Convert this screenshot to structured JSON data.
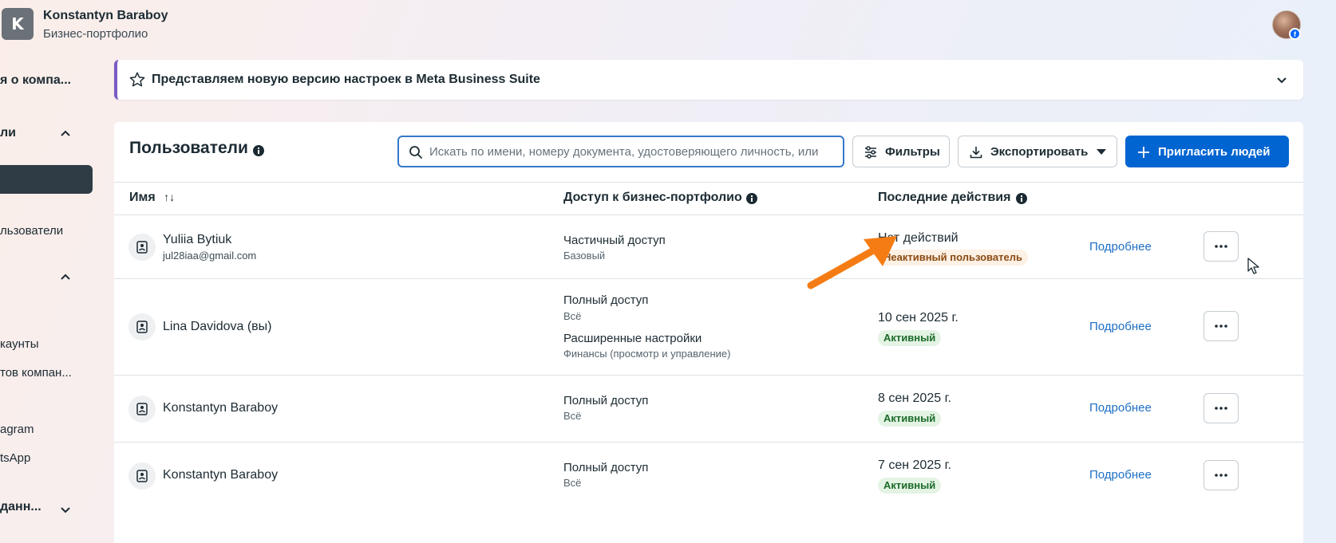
{
  "header": {
    "logo_letter": "K",
    "account_name": "Konstantyn Baraboy",
    "account_subtitle": "Бизнес-портфолио"
  },
  "sidebar": {
    "items": [
      {
        "label": "я о компа..."
      },
      {
        "label": "ли"
      },
      {
        "label": "льзователи"
      },
      {
        "label": "каунты"
      },
      {
        "label": "тов компан..."
      },
      {
        "label": "agram"
      },
      {
        "label": "tsApp"
      },
      {
        "label": "данн..."
      }
    ]
  },
  "banner": {
    "text": "Представляем новую версию настроек в Meta Business Suite"
  },
  "users_panel": {
    "title": "Пользователи",
    "search_placeholder": "Искать по имени, номеру документа, удостоверяющего личность, или",
    "filters_label": "Фильтры",
    "export_label": "Экспортировать",
    "invite_label": "Пригласить людей",
    "columns": {
      "name": "Имя",
      "sort_glyph": "↑↓",
      "access": "Доступ к бизнес-портфолио",
      "activity": "Последние действия"
    },
    "rows": [
      {
        "name": "Yuliia Bytiuk",
        "email": "jul28iaa@gmail.com",
        "access": [
          {
            "main": "Частичный доступ",
            "sub": "Базовый"
          }
        ],
        "activity": "Нет действий",
        "status": "Неактивный пользователь",
        "details": "Подробнее"
      },
      {
        "name": "Lina Davidova (вы)",
        "email": "",
        "access": [
          {
            "main": "Полный доступ",
            "sub": "Всё"
          },
          {
            "main": "Расширенные настройки",
            "sub": "Финансы (просмотр и управление)"
          }
        ],
        "activity": "10 сен 2025 г.",
        "status": "Активный",
        "details": "Подробнее"
      },
      {
        "name": "Konstantyn Baraboy",
        "email": "",
        "access": [
          {
            "main": "Полный доступ",
            "sub": "Всё"
          }
        ],
        "activity": "8 сен 2025 г.",
        "status": "Активный",
        "details": "Подробнее"
      },
      {
        "name": "Konstantyn Baraboy",
        "email": "",
        "access": [
          {
            "main": "Полный доступ",
            "sub": "Всё"
          }
        ],
        "activity": "7 сен 2025 г.",
        "status": "Активный",
        "details": "Подробнее"
      }
    ]
  },
  "colors": {
    "primary": "#0064d1",
    "link": "#1d6ec5",
    "arrow": "#f57c14",
    "banner_accent": "#7a5bc4",
    "active_badge": "#e4f4e4",
    "inactive_badge": "#fdf0e4"
  }
}
